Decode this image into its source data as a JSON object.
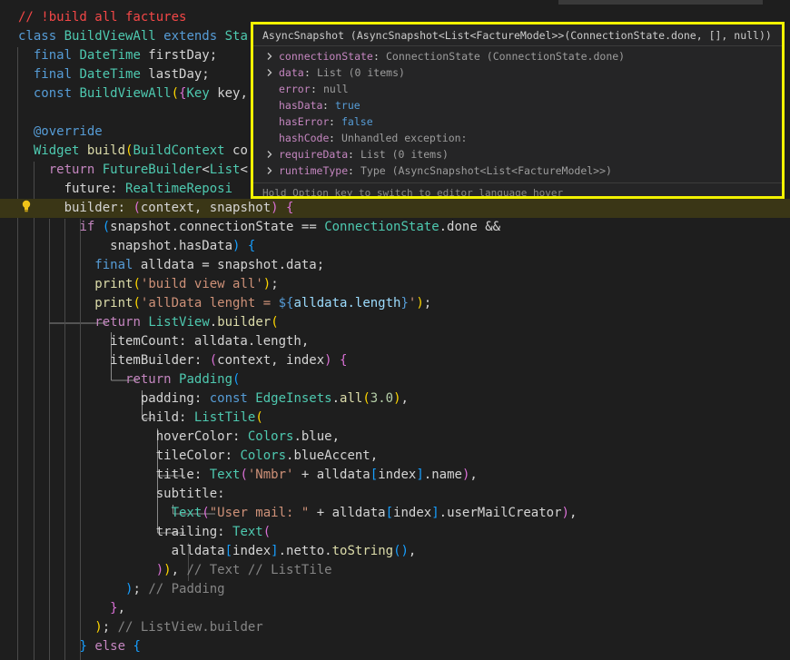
{
  "code": {
    "lines": [
      [
        [
          "red",
          "// !build all factures"
        ]
      ],
      [
        [
          "kw",
          "class "
        ],
        [
          "ty",
          "BuildViewAll "
        ],
        [
          "kw",
          "extends "
        ],
        [
          "ty",
          "Sta"
        ]
      ],
      [
        [
          "var",
          "  "
        ],
        [
          "kw",
          "final "
        ],
        [
          "ty",
          "DateTime "
        ],
        [
          "var",
          "firstDay;"
        ]
      ],
      [
        [
          "var",
          "  "
        ],
        [
          "kw",
          "final "
        ],
        [
          "ty",
          "DateTime "
        ],
        [
          "var",
          "lastDay;"
        ]
      ],
      [
        [
          "var",
          "  "
        ],
        [
          "kw",
          "const "
        ],
        [
          "ty",
          "BuildViewAll"
        ],
        [
          "b1",
          "("
        ],
        [
          "b2",
          "{"
        ],
        [
          "ty",
          "Key "
        ],
        [
          "var",
          "key,"
        ]
      ],
      [],
      [
        [
          "var",
          "  "
        ],
        [
          "kw",
          "@override"
        ]
      ],
      [
        [
          "var",
          "  "
        ],
        [
          "ty",
          "Widget "
        ],
        [
          "fn",
          "build"
        ],
        [
          "b1",
          "("
        ],
        [
          "ty",
          "BuildContext "
        ],
        [
          "var",
          "co"
        ]
      ],
      [
        [
          "var",
          "    "
        ],
        [
          "ctl",
          "return "
        ],
        [
          "ty",
          "FutureBuilder"
        ],
        [
          "var",
          "<"
        ],
        [
          "ty",
          "List"
        ],
        [
          "var",
          "<"
        ]
      ],
      [
        [
          "var",
          "      future: "
        ],
        [
          "ty",
          "RealtimeReposi"
        ]
      ],
      [
        [
          "var",
          "      builder: "
        ],
        [
          "b2",
          "("
        ],
        [
          "var",
          "context, snapshot"
        ],
        [
          "b2",
          ")"
        ],
        [
          "var",
          " "
        ],
        [
          "b2",
          "{"
        ]
      ],
      [
        [
          "var",
          "        "
        ],
        [
          "ctl",
          "if "
        ],
        [
          "b3",
          "("
        ],
        [
          "var",
          "snapshot.connectionState == "
        ],
        [
          "ty",
          "ConnectionState"
        ],
        [
          "var",
          ".done &&"
        ]
      ],
      [
        [
          "var",
          "            snapshot.hasData"
        ],
        [
          "b3",
          ")"
        ],
        [
          "var",
          " "
        ],
        [
          "b3",
          "{"
        ]
      ],
      [
        [
          "var",
          "          "
        ],
        [
          "kw",
          "final "
        ],
        [
          "var",
          "alldata = snapshot.data;"
        ]
      ],
      [
        [
          "var",
          "          "
        ],
        [
          "fn",
          "print"
        ],
        [
          "b1",
          "("
        ],
        [
          "str",
          "'build view all'"
        ],
        [
          "b1",
          ")"
        ],
        [
          "var",
          ";"
        ]
      ],
      [
        [
          "var",
          "          "
        ],
        [
          "fn",
          "print"
        ],
        [
          "b1",
          "("
        ],
        [
          "str",
          "'allData lenght = "
        ],
        [
          "kw",
          "${"
        ],
        [
          "prop",
          "alldata.length"
        ],
        [
          "kw",
          "}"
        ],
        [
          "str",
          "'"
        ],
        [
          "b1",
          ")"
        ],
        [
          "var",
          ";"
        ]
      ],
      [
        [
          "var",
          "          "
        ],
        [
          "ctl",
          "return "
        ],
        [
          "ty",
          "ListView"
        ],
        [
          "var",
          "."
        ],
        [
          "fn",
          "builder"
        ],
        [
          "b1",
          "("
        ]
      ],
      [
        [
          "var",
          "            itemCount: alldata.length,"
        ]
      ],
      [
        [
          "var",
          "            itemBuilder: "
        ],
        [
          "b2",
          "("
        ],
        [
          "var",
          "context, index"
        ],
        [
          "b2",
          ")"
        ],
        [
          "var",
          " "
        ],
        [
          "b2",
          "{"
        ]
      ],
      [
        [
          "var",
          "              "
        ],
        [
          "ctl",
          "return "
        ],
        [
          "ty",
          "Padding"
        ],
        [
          "b3",
          "("
        ]
      ],
      [
        [
          "var",
          "                padding: "
        ],
        [
          "kw",
          "const "
        ],
        [
          "ty",
          "EdgeInsets"
        ],
        [
          "var",
          "."
        ],
        [
          "fn",
          "all"
        ],
        [
          "b1",
          "("
        ],
        [
          "num",
          "3.0"
        ],
        [
          "b1",
          ")"
        ],
        [
          "var",
          ","
        ]
      ],
      [
        [
          "var",
          "                child: "
        ],
        [
          "ty",
          "ListTile"
        ],
        [
          "b1",
          "("
        ]
      ],
      [
        [
          "var",
          "                  hoverColor: "
        ],
        [
          "ty",
          "Colors"
        ],
        [
          "var",
          ".blue,"
        ]
      ],
      [
        [
          "var",
          "                  tileColor: "
        ],
        [
          "ty",
          "Colors"
        ],
        [
          "var",
          ".blueAccent,"
        ]
      ],
      [
        [
          "var",
          "                  title: "
        ],
        [
          "ty",
          "Text"
        ],
        [
          "b2",
          "("
        ],
        [
          "str",
          "'Nmbr'"
        ],
        [
          "var",
          " + alldata"
        ],
        [
          "b3",
          "["
        ],
        [
          "var",
          "index"
        ],
        [
          "b3",
          "]"
        ],
        [
          "var",
          ".name"
        ],
        [
          "b2",
          ")"
        ],
        [
          "var",
          ","
        ]
      ],
      [
        [
          "var",
          "                  subtitle:"
        ]
      ],
      [
        [
          "var",
          "                    "
        ],
        [
          "ty",
          "Text"
        ],
        [
          "b2",
          "("
        ],
        [
          "str",
          "\"User mail: \""
        ],
        [
          "var",
          " + alldata"
        ],
        [
          "b3",
          "["
        ],
        [
          "var",
          "index"
        ],
        [
          "b3",
          "]"
        ],
        [
          "var",
          ".userMailCreator"
        ],
        [
          "b2",
          ")"
        ],
        [
          "var",
          ","
        ]
      ],
      [
        [
          "var",
          "                  trailing: "
        ],
        [
          "ty",
          "Text"
        ],
        [
          "b2",
          "("
        ]
      ],
      [
        [
          "var",
          "                    alldata"
        ],
        [
          "b3",
          "["
        ],
        [
          "var",
          "index"
        ],
        [
          "b3",
          "]"
        ],
        [
          "var",
          ".netto."
        ],
        [
          "fn",
          "toString"
        ],
        [
          "b3",
          "()"
        ],
        [
          "var",
          ","
        ]
      ],
      [
        [
          "var",
          "                  "
        ],
        [
          "b2",
          ")"
        ],
        [
          "b1",
          ")"
        ],
        [
          "var",
          ", "
        ],
        [
          "cmg",
          "// Text // ListTile"
        ]
      ],
      [
        [
          "var",
          "              "
        ],
        [
          "b3",
          ")"
        ],
        [
          "var",
          "; "
        ],
        [
          "cmg",
          "// Padding"
        ]
      ],
      [
        [
          "var",
          "            "
        ],
        [
          "b2",
          "}"
        ],
        [
          "var",
          ","
        ]
      ],
      [
        [
          "var",
          "          "
        ],
        [
          "b1",
          ")"
        ],
        [
          "var",
          "; "
        ],
        [
          "cmg",
          "// ListView.builder"
        ]
      ],
      [
        [
          "var",
          "        "
        ],
        [
          "b3",
          "}"
        ],
        [
          "var",
          " "
        ],
        [
          "ctl",
          "else "
        ],
        [
          "b3",
          "{"
        ]
      ]
    ]
  },
  "hover": {
    "header": "AsyncSnapshot (AsyncSnapshot<List<FactureModel>>(ConnectionState.done, [], null))",
    "rows": [
      {
        "expandable": true,
        "name": "connectionState",
        "value": "ConnectionState (ConnectionState.done)",
        "value_color": "#9d9d9d"
      },
      {
        "expandable": true,
        "name": "data",
        "value": "List (0 items)",
        "value_color": "#9d9d9d"
      },
      {
        "expandable": false,
        "name": "error",
        "value": "null",
        "value_color": "#9d9d9d"
      },
      {
        "expandable": false,
        "name": "hasData",
        "value": "true",
        "value_color": "#569cd6"
      },
      {
        "expandable": false,
        "name": "hasError",
        "value": "false",
        "value_color": "#569cd6"
      },
      {
        "expandable": false,
        "name": "hashCode",
        "value": "Unhandled exception:",
        "value_color": "#9d9d9d"
      },
      {
        "expandable": true,
        "name": "requireData",
        "value": "List (0 items)",
        "value_color": "#9d9d9d"
      },
      {
        "expandable": true,
        "name": "runtimeType",
        "value": "Type (AsyncSnapshot<List<FactureModel>>)",
        "value_color": "#9d9d9d"
      }
    ],
    "footer": "Hold Option key to switch to editor language hover"
  }
}
